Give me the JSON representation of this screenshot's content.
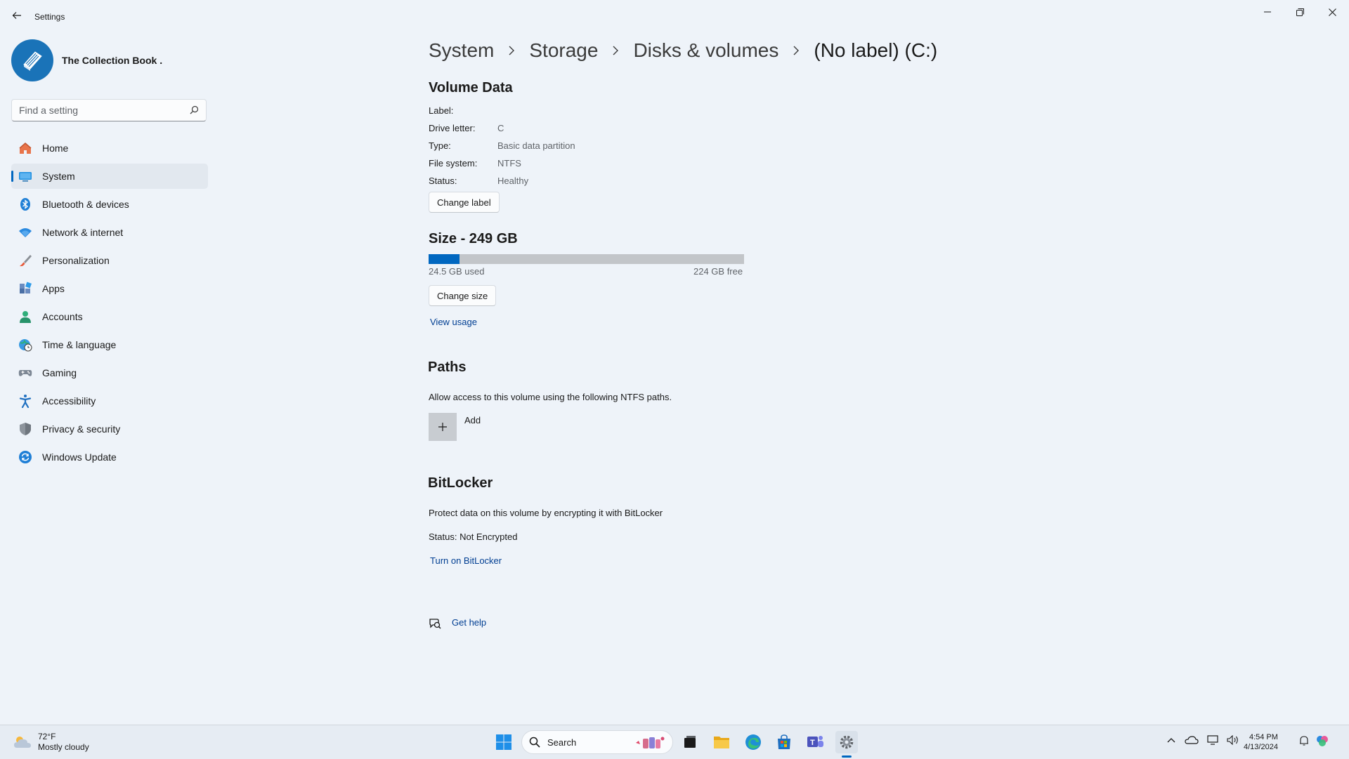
{
  "window": {
    "app_title": "Settings",
    "profile_name": "The Collection Book ."
  },
  "search": {
    "placeholder": "Find a setting"
  },
  "sidebar": {
    "items": [
      {
        "label": "Home",
        "icon": "home-icon"
      },
      {
        "label": "System",
        "icon": "system-icon",
        "selected": true
      },
      {
        "label": "Bluetooth & devices",
        "icon": "bluetooth-icon"
      },
      {
        "label": "Network & internet",
        "icon": "wifi-icon"
      },
      {
        "label": "Personalization",
        "icon": "brush-icon"
      },
      {
        "label": "Apps",
        "icon": "apps-icon"
      },
      {
        "label": "Accounts",
        "icon": "accounts-icon"
      },
      {
        "label": "Time & language",
        "icon": "globe-clock-icon"
      },
      {
        "label": "Gaming",
        "icon": "gamepad-icon"
      },
      {
        "label": "Accessibility",
        "icon": "accessibility-icon"
      },
      {
        "label": "Privacy & security",
        "icon": "shield-icon"
      },
      {
        "label": "Windows Update",
        "icon": "update-icon"
      }
    ]
  },
  "breadcrumb": [
    "System",
    "Storage",
    "Disks & volumes",
    "(No label) (C:)"
  ],
  "volume": {
    "title": "Volume Data",
    "fields": [
      {
        "key": "Label:",
        "value": ""
      },
      {
        "key": "Drive letter:",
        "value": "C"
      },
      {
        "key": "Type:",
        "value": "Basic data partition"
      },
      {
        "key": "File system:",
        "value": "NTFS"
      },
      {
        "key": "Status:",
        "value": "Healthy"
      }
    ],
    "change_label_button": "Change label"
  },
  "size": {
    "title": "Size - 249 GB",
    "used_text": "24.5 GB used",
    "free_text": "224 GB free",
    "used_fraction": 0.098,
    "change_size_button": "Change size",
    "view_usage_link": "View usage"
  },
  "paths": {
    "title": "Paths",
    "description": "Allow access to this volume using the following NTFS paths.",
    "add_label": "Add"
  },
  "bitlocker": {
    "title": "BitLocker",
    "description": "Protect data on this volume by encrypting it with BitLocker",
    "status": "Status: Not Encrypted",
    "turn_on_link": "Turn on BitLocker"
  },
  "help": {
    "get_help_link": "Get help"
  },
  "taskbar": {
    "weather_temp": "72°F",
    "weather_desc": "Mostly cloudy",
    "search_label": "Search",
    "time": "4:54 PM",
    "date": "4/13/2024"
  },
  "colors": {
    "accent": "#0067c0",
    "link": "#003e92",
    "background": "#eef3f9"
  }
}
